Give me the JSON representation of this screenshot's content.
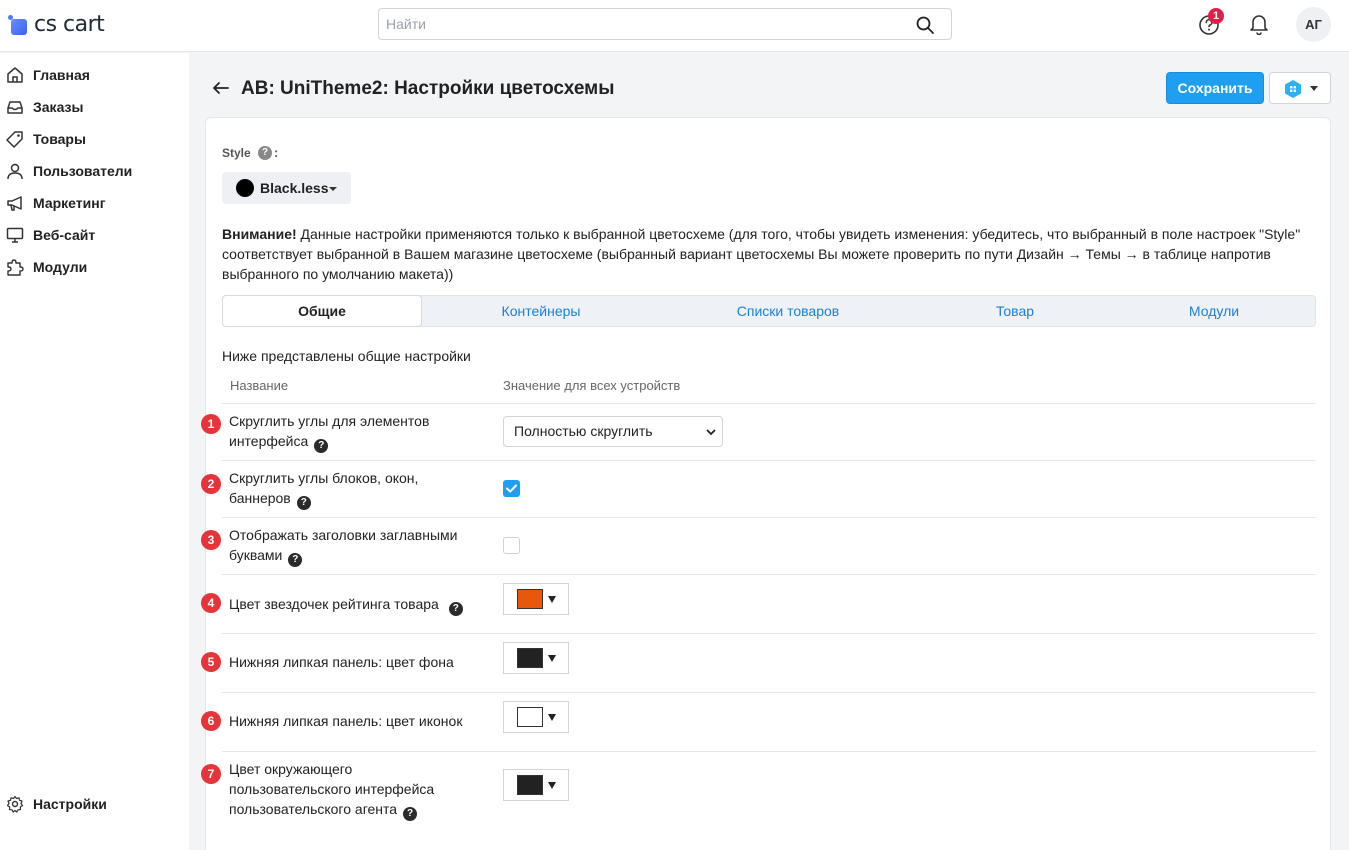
{
  "header": {
    "logo_text": "cs cart",
    "search_placeholder": "Найти",
    "help_badge": "1",
    "avatar": "АГ"
  },
  "sidebar": {
    "items": [
      {
        "label": "Главная",
        "icon": "home-icon"
      },
      {
        "label": "Заказы",
        "icon": "inbox-icon"
      },
      {
        "label": "Товары",
        "icon": "tag-icon"
      },
      {
        "label": "Пользователи",
        "icon": "user-icon"
      },
      {
        "label": "Маркетинг",
        "icon": "megaphone-icon"
      },
      {
        "label": "Веб-сайт",
        "icon": "monitor-icon"
      },
      {
        "label": "Модули",
        "icon": "puzzle-icon"
      }
    ],
    "settings_label": "Настройки"
  },
  "page": {
    "title": "AB: UniTheme2: Настройки цветосхемы",
    "save_label": "Сохранить"
  },
  "style": {
    "label": "Style",
    "help": "?",
    "colon": ":",
    "selected": "Black.less",
    "swatch_color": "#000000"
  },
  "notice": {
    "bold": "Внимание!",
    "text": " Данные настройки применяются только к выбранной цветосхеме (для того, чтобы увидеть изменения: убедитесь, что выбранный в поле настроек \"Style\" соответствует выбранной в Вашем магазине цветосхеме (выбранный вариант цветосхемы Вы можете проверить по пути Дизайн → Темы → в таблице напротив выбранного по умолчанию макета))"
  },
  "tabs": [
    {
      "label": "Общие",
      "active": true
    },
    {
      "label": "Контейнеры",
      "active": false
    },
    {
      "label": "Списки товаров",
      "active": false
    },
    {
      "label": "Товар",
      "active": false
    },
    {
      "label": "Модули",
      "active": false
    }
  ],
  "section": {
    "note": "Ниже представлены общие настройки",
    "col_name": "Название",
    "col_value": "Значение для всех устройств"
  },
  "rows": [
    {
      "num": "1",
      "label": "Скруглить углы для элементов интерфейса",
      "control": "select",
      "value": "Полностью скруглить"
    },
    {
      "num": "2",
      "label": "Скруглить углы блоков, окон, баннеров",
      "control": "checkbox",
      "checked": true
    },
    {
      "num": "3",
      "label": "Отображать заголовки заглавными буквами",
      "control": "checkbox",
      "checked": false
    },
    {
      "num": "4",
      "label": "Цвет звездочек рейтинга товара",
      "control": "color",
      "color": "#e8580c"
    },
    {
      "num": "5",
      "label": "Нижняя липкая панель: цвет фона",
      "control": "color",
      "color": "#222222"
    },
    {
      "num": "6",
      "label": "Нижняя липкая панель: цвет иконок",
      "control": "color",
      "color": "#ffffff"
    },
    {
      "num": "7",
      "label": "Цвет окружающего пользовательского интерфейса пользовательского агента",
      "control": "color",
      "color": "#222222"
    }
  ],
  "help_mark": "?",
  "colors": {
    "accent": "#1e9ff2",
    "badge": "#e11d48",
    "step_marker": "#e5343a"
  }
}
